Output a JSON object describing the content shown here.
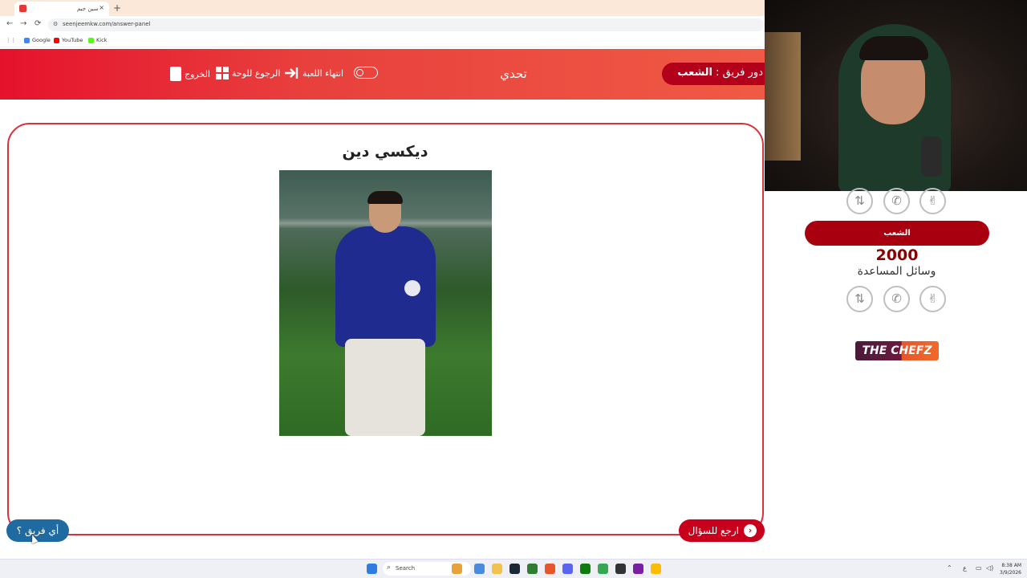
{
  "browser": {
    "tab_title": "سين جيم",
    "tab_close": "×",
    "new_tab": "+",
    "url": "seenjeemkw.com/answer-panel",
    "nav": {
      "back": "←",
      "forward": "→",
      "reload": "⟳"
    },
    "bookmarks": [
      {
        "label": "Google",
        "color": "#4285f4"
      },
      {
        "label": "YouTube",
        "color": "#ff0000"
      },
      {
        "label": "Kick",
        "color": "#53fc18"
      }
    ]
  },
  "header": {
    "turn_prefix": "دور فريق :",
    "turn_team": "الشعب",
    "title": "تحدي",
    "end_game_label": "انتهاء اللعبة",
    "back_to_board_label": "الرجوع للوحة",
    "exit_label": "الخروج"
  },
  "answer": {
    "name": "ديكسي دين"
  },
  "buttons": {
    "back_to_question": "ارجع للسؤال",
    "back_to_question_icon": "›",
    "which_team": "أي فريق ؟"
  },
  "scoreboard": {
    "team_name": "الشعب",
    "score": "2000",
    "aids_label": "وسائل المساعدة",
    "lifelines_top": [
      {
        "icon": "swap-icon",
        "glyph": "⇅"
      },
      {
        "icon": "phone-icon",
        "glyph": "✆"
      },
      {
        "icon": "peace-hand-icon",
        "glyph": "✌"
      }
    ],
    "lifelines_bottom": [
      {
        "icon": "swap-icon",
        "glyph": "⇅"
      },
      {
        "icon": "phone-icon",
        "glyph": "✆"
      },
      {
        "icon": "peace-hand-icon",
        "glyph": "✌"
      }
    ]
  },
  "sponsor": {
    "logo_text": "THE CHEFZ"
  },
  "taskbar": {
    "search_placeholder": "Search",
    "time": "8:38 AM",
    "date": "3/9/2026",
    "lang": "ع"
  },
  "colors": {
    "header_red": "#e5122c",
    "pill_dark_red": "#b3001b",
    "team_blue": "#1f6aa1",
    "score_red": "#8b0000"
  }
}
